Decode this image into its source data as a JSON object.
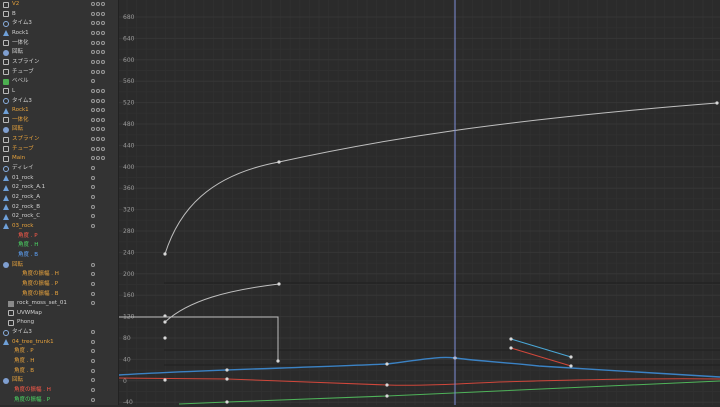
{
  "tree": {
    "rows": [
      {
        "label": "V2",
        "color": "orange",
        "icon": "object-icon",
        "toggles": 3,
        "indent": 3
      },
      {
        "label": "B",
        "color": "white",
        "icon": "object-icon",
        "toggles": 3,
        "indent": 3
      },
      {
        "label": "タイム3",
        "color": "white",
        "icon": "clock-icon",
        "toggles": 3,
        "indent": 3
      },
      {
        "label": "Rock1",
        "color": "white",
        "icon": "rock-icon",
        "toggles": 3,
        "indent": 3
      },
      {
        "label": "一体化",
        "color": "white",
        "icon": "connect-icon",
        "toggles": 3,
        "indent": 3
      },
      {
        "label": "回転",
        "color": "white",
        "icon": "rotate-icon",
        "toggles": 3,
        "indent": 3
      },
      {
        "label": "スプライン",
        "color": "white",
        "icon": "spline-icon",
        "toggles": 3,
        "indent": 3
      },
      {
        "label": "チューブ",
        "color": "white",
        "icon": "tube-icon",
        "toggles": 3,
        "indent": 3
      },
      {
        "label": "ベベル",
        "color": "white",
        "icon": "bevel-icon",
        "toggles": 1,
        "indent": 3
      },
      {
        "label": "L",
        "color": "white",
        "icon": "object-icon",
        "toggles": 3,
        "indent": 3
      },
      {
        "label": "タイム3",
        "color": "white",
        "icon": "clock-icon",
        "toggles": 3,
        "indent": 3
      },
      {
        "label": "Rock1",
        "color": "orange",
        "icon": "rock-icon",
        "toggles": 3,
        "indent": 3
      },
      {
        "label": "一体化",
        "color": "orange",
        "icon": "connect-icon",
        "toggles": 3,
        "indent": 3
      },
      {
        "label": "回転",
        "color": "orange",
        "icon": "rotate-icon",
        "toggles": 3,
        "indent": 3
      },
      {
        "label": "スプライン",
        "color": "orange",
        "icon": "spline-icon",
        "toggles": 3,
        "indent": 3
      },
      {
        "label": "チューブ",
        "color": "orange",
        "icon": "tube-icon",
        "toggles": 3,
        "indent": 3
      },
      {
        "label": "Main",
        "color": "orange",
        "icon": "object-icon",
        "toggles": 3,
        "indent": 3
      },
      {
        "label": "ディレイ",
        "color": "white",
        "icon": "delay-icon",
        "toggles": 1,
        "indent": 3
      },
      {
        "label": "01_rock",
        "color": "white",
        "icon": "rock-icon",
        "toggles": 1,
        "indent": 3
      },
      {
        "label": "02_rock_A.1",
        "color": "white",
        "icon": "rock-icon",
        "toggles": 1,
        "indent": 3
      },
      {
        "label": "02_rock_A",
        "color": "white",
        "icon": "rock-icon",
        "toggles": 1,
        "indent": 3
      },
      {
        "label": "02_rock_B",
        "color": "white",
        "icon": "rock-icon",
        "toggles": 1,
        "indent": 3
      },
      {
        "label": "02_rock_C",
        "color": "white",
        "icon": "rock-icon",
        "toggles": 1,
        "indent": 3
      },
      {
        "label": "03_rock",
        "color": "orange",
        "icon": "rock-icon",
        "toggles": 1,
        "indent": 3
      },
      {
        "label": "角度 . P",
        "color": "red",
        "icon": "none",
        "toggles": 0,
        "indent": 18
      },
      {
        "label": "角度 . H",
        "color": "green",
        "icon": "none",
        "toggles": 0,
        "indent": 18
      },
      {
        "label": "角度 . B",
        "color": "blue",
        "icon": "none",
        "toggles": 0,
        "indent": 18
      },
      {
        "label": "回転",
        "color": "orange",
        "icon": "rotate-icon",
        "toggles": 1,
        "indent": 3
      },
      {
        "label": "角度の振幅 . H",
        "color": "orange",
        "icon": "none",
        "toggles": 1,
        "indent": 22
      },
      {
        "label": "角度の振幅 . P",
        "color": "orange",
        "icon": "none",
        "toggles": 1,
        "indent": 22
      },
      {
        "label": "角度の振幅 . B",
        "color": "orange",
        "icon": "none",
        "toggles": 1,
        "indent": 22
      },
      {
        "label": "rock_moss_set_01",
        "color": "white",
        "icon": "material-icon",
        "toggles": 1,
        "indent": 8
      },
      {
        "label": "UVWMap",
        "color": "white",
        "icon": "uvw-icon",
        "toggles": 0,
        "indent": 8
      },
      {
        "label": "Phong",
        "color": "white",
        "icon": "phong-icon",
        "toggles": 0,
        "indent": 8
      },
      {
        "label": "タイム3",
        "color": "white",
        "icon": "clock-icon",
        "toggles": 1,
        "indent": 3
      },
      {
        "label": "04_tree_trunk1",
        "color": "orange",
        "icon": "rock-icon",
        "toggles": 1,
        "indent": 3
      },
      {
        "label": "角度 . P",
        "color": "orange",
        "icon": "none",
        "toggles": 1,
        "indent": 14
      },
      {
        "label": "角度 . H",
        "color": "orange",
        "icon": "none",
        "toggles": 1,
        "indent": 14
      },
      {
        "label": "角度 . B",
        "color": "orange",
        "icon": "none",
        "toggles": 1,
        "indent": 14
      },
      {
        "label": "回転",
        "color": "orange",
        "icon": "rotate-icon",
        "toggles": 1,
        "indent": 3
      },
      {
        "label": "角度の振幅 . H",
        "color": "red",
        "icon": "none",
        "toggles": 1,
        "indent": 14
      },
      {
        "label": "角度の振幅 . P",
        "color": "green",
        "icon": "none",
        "toggles": 1,
        "indent": 14
      }
    ]
  },
  "graph": {
    "y_ticks": [
      "680",
      "640",
      "600",
      "560",
      "520",
      "480",
      "440",
      "400",
      "360",
      "320",
      "280",
      "240",
      "200",
      "160",
      "120",
      "80",
      "40",
      "0",
      "-40"
    ],
    "y_range": [
      -50,
      690
    ],
    "playhead_label": "",
    "colors": {
      "white": "#bfbfbf",
      "red": "#d0473b",
      "green": "#4fb35a",
      "blue": "#3b82c4",
      "cyan": "#4aa8d8",
      "playhead": "#7f8fd9"
    }
  }
}
